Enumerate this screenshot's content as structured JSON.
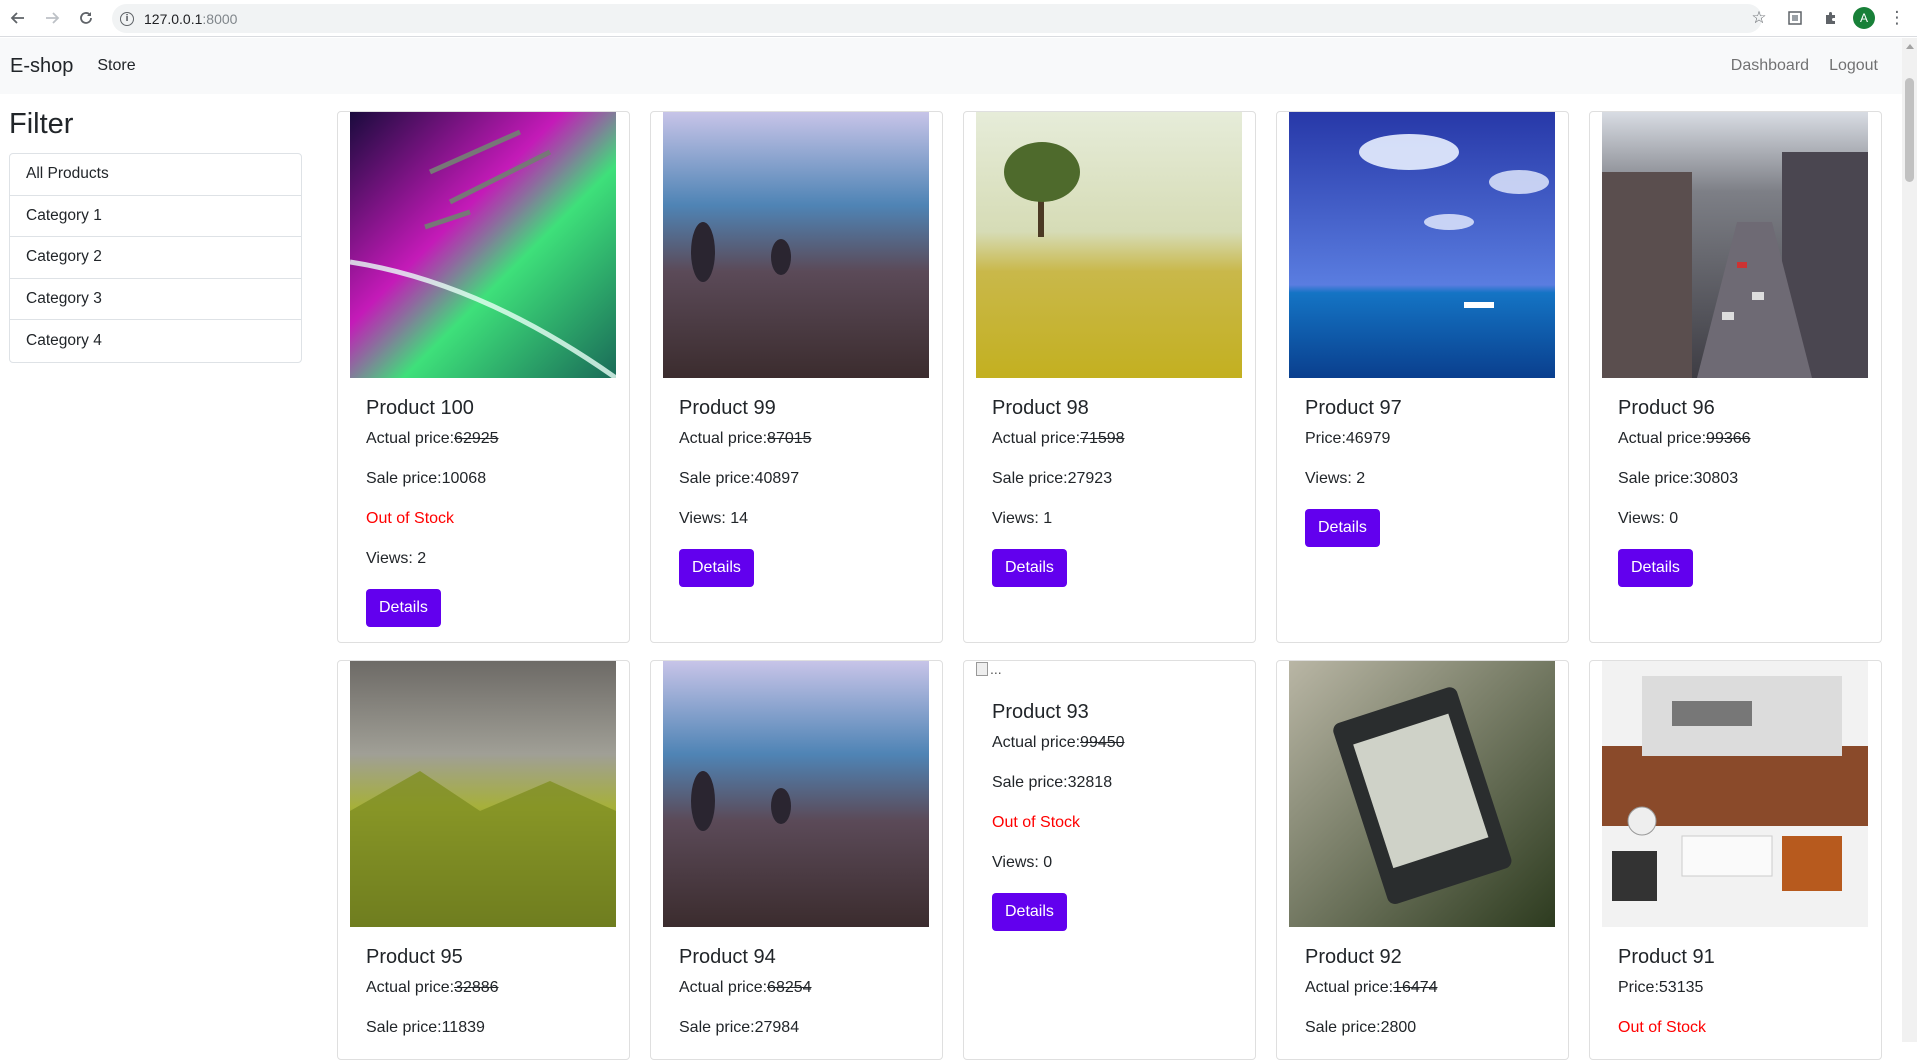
{
  "browser": {
    "url_host": "127.0.0.1",
    "url_port": ":8000",
    "profile_initial": "A"
  },
  "navbar": {
    "brand": "E-shop",
    "store": "Store",
    "dashboard": "Dashboard",
    "logout": "Logout"
  },
  "filter": {
    "title": "Filter",
    "items": [
      "All Products",
      "Category 1",
      "Category 2",
      "Category 3",
      "Category 4"
    ]
  },
  "labels": {
    "actual_price": "Actual price:",
    "sale_price": "Sale price:",
    "price": "Price:",
    "views": "Views: ",
    "out_of_stock": "Out of Stock",
    "details": "Details",
    "broken_alt": "..."
  },
  "products": [
    {
      "title": "Product 100",
      "image": "space-station-aurora",
      "actual_price": "62925",
      "sale_price": "10068",
      "out_of_stock": true,
      "views": "2"
    },
    {
      "title": "Product 99",
      "image": "misty-field-figures",
      "actual_price": "87015",
      "sale_price": "40897",
      "out_of_stock": false,
      "views": "14"
    },
    {
      "title": "Product 98",
      "image": "tree-yellow-field",
      "actual_price": "71598",
      "sale_price": "27923",
      "out_of_stock": false,
      "views": "1"
    },
    {
      "title": "Product 97",
      "image": "boat-blue-sea",
      "price": "46979",
      "out_of_stock": false,
      "views": "2"
    },
    {
      "title": "Product 96",
      "image": "city-traffic",
      "actual_price": "99366",
      "sale_price": "30803",
      "out_of_stock": false,
      "views": "0"
    },
    {
      "title": "Product 95",
      "image": "green-valley-clouds",
      "actual_price": "32886",
      "sale_price": "11839"
    },
    {
      "title": "Product 94",
      "image": "misty-field-figures",
      "actual_price": "68254",
      "sale_price": "27984"
    },
    {
      "title": "Product 93",
      "image": "broken",
      "actual_price": "99450",
      "sale_price": "32818",
      "out_of_stock": true,
      "views": "0"
    },
    {
      "title": "Product 92",
      "image": "kindle-reader",
      "actual_price": "16474",
      "sale_price": "2800"
    },
    {
      "title": "Product 91",
      "image": "desk-workspace",
      "price": "53135",
      "out_of_stock": true
    }
  ]
}
